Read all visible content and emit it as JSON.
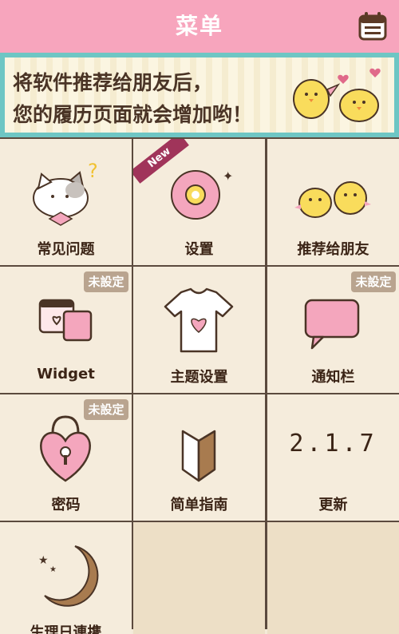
{
  "header": {
    "title": "菜单",
    "calendar_icon": "calendar-icon"
  },
  "banner": {
    "line1": "将软件推荐给朋友后，",
    "line2": "您的履历页面就会增加哟！"
  },
  "menu": {
    "faq": {
      "label": "常见问题",
      "icon": "cat-icon"
    },
    "settings": {
      "label": "设置",
      "icon": "flower-gear-icon",
      "ribbon": "New"
    },
    "recommend": {
      "label": "推荐给朋友",
      "icon": "chicks-icon"
    },
    "widget": {
      "label": "Widget",
      "icon": "widget-icon",
      "badge": "未設定"
    },
    "theme": {
      "label": "主题设置",
      "icon": "shirt-icon"
    },
    "notify": {
      "label": "通知栏",
      "icon": "speech-bubble-icon",
      "badge": "未設定"
    },
    "password": {
      "label": "密码",
      "icon": "heart-lock-icon",
      "badge": "未設定"
    },
    "guide": {
      "label": "简单指南",
      "icon": "beginner-mark-icon"
    },
    "update": {
      "label": "更新",
      "version": "2.1.7"
    },
    "cycle": {
      "label": "生理日連携",
      "icon": "moon-icon"
    }
  },
  "colors": {
    "header": "#f7a5bd",
    "banner_border": "#6ec6c4",
    "text": "#3b2416",
    "badge": "#b9a48f"
  }
}
